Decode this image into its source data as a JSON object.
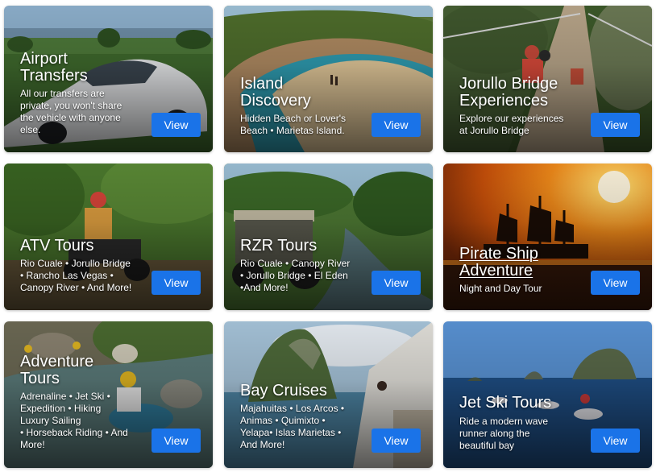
{
  "cards": [
    {
      "title_lines": [
        "Airport",
        "Transfers"
      ],
      "desc_lines": [
        "All our transfers are",
        "private, you won't share",
        "the vehicle with anyone",
        "else."
      ],
      "button": "View",
      "image": "white sedan on golf course"
    },
    {
      "title_lines": [
        "Island",
        "Discovery"
      ],
      "desc_lines": [
        "Hidden Beach or Lover's",
        "Beach • Marietas Island."
      ],
      "button": "View",
      "image": "hidden beach inside rock crater"
    },
    {
      "title_lines": [
        "Jorullo Bridge",
        "Experiences"
      ],
      "desc_lines": [
        "Explore our experiences",
        "at Jorullo Bridge"
      ],
      "button": "View",
      "image": "riders on suspension bridge"
    },
    {
      "title_lines": [
        "ATV Tours"
      ],
      "desc_lines": [
        "Rio Cuale • Jorullo Bridge",
        "• Rancho Las Vegas •",
        "Canopy River • And More!"
      ],
      "button": "View",
      "image": "rider on ATV in jungle"
    },
    {
      "title_lines": [
        "RZR Tours"
      ],
      "desc_lines": [
        "Rio Cuale • Canopy River",
        "• Jorullo Bridge • El Eden",
        "•And More!"
      ],
      "button": "View",
      "image": "RZR buggy by river"
    },
    {
      "title_lines": [
        "Pirate Ship",
        "Adventure"
      ],
      "desc_lines": [
        "Night and Day Tour"
      ],
      "button": "View",
      "image": "pirate ship at sunset"
    },
    {
      "title_lines": [
        "Adventure",
        "Tours"
      ],
      "desc_lines": [
        "Adrenaline • Jet Ski •",
        "Expedition • Hiking",
        "Luxury Sailing",
        "• Horseback Riding • And",
        "More!"
      ],
      "button": "View",
      "image": "river tubing in canyon"
    },
    {
      "title_lines": [
        "Bay Cruises"
      ],
      "desc_lines": [
        "Majahuitas • Los Arcos •",
        "Animas • Quimixto •",
        "Yelapa• Islas Marietas •",
        "And More!"
      ],
      "button": "View",
      "image": "rock island seen from boat"
    },
    {
      "title_lines": [
        "Jet Ski Tours"
      ],
      "desc_lines": [
        "Ride a modern wave",
        "runner along the",
        "beautiful bay"
      ],
      "button": "View",
      "image": "jet skis near rock islands"
    }
  ],
  "colors": {
    "button_bg": "#1a73e8",
    "text": "#ffffff"
  }
}
